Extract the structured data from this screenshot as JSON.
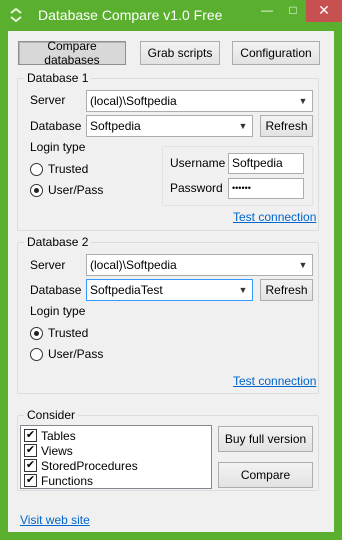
{
  "window": {
    "title": "Database Compare v1.0 Free",
    "minimize_glyph": "—",
    "maximize_glyph": "□",
    "close_glyph": "✕",
    "accent_color": "#5ab02e"
  },
  "toolbar": {
    "compare_label": "Compare databases",
    "grab_label": "Grab scripts",
    "config_label": "Configuration"
  },
  "db1": {
    "group_label": "Database 1",
    "server_label": "Server",
    "server_value": "(local)\\Softpedia",
    "database_label": "Database",
    "database_value": "Softpedia",
    "refresh_label": "Refresh",
    "login_type_label": "Login type",
    "trusted_label": "Trusted",
    "userpass_label": "User/Pass",
    "selected_login": "userpass",
    "username_label": "Username",
    "username_value": "Softpedia",
    "password_label": "Password",
    "password_value": "••••••",
    "test_label": "Test connection"
  },
  "db2": {
    "group_label": "Database 2",
    "server_label": "Server",
    "server_value": "(local)\\Softpedia",
    "database_label": "Database",
    "database_value": "SoftpediaTest",
    "refresh_label": "Refresh",
    "login_type_label": "Login type",
    "trusted_label": "Trusted",
    "userpass_label": "User/Pass",
    "selected_login": "trusted",
    "test_label": "Test connection"
  },
  "consider": {
    "group_label": "Consider",
    "items": [
      {
        "label": "Tables",
        "checked": true
      },
      {
        "label": "Views",
        "checked": true
      },
      {
        "label": "StoredProcedures",
        "checked": true
      },
      {
        "label": "Functions",
        "checked": true
      }
    ],
    "buy_label": "Buy full version",
    "compare_label": "Compare"
  },
  "footer": {
    "visit_label": "Visit web site"
  }
}
